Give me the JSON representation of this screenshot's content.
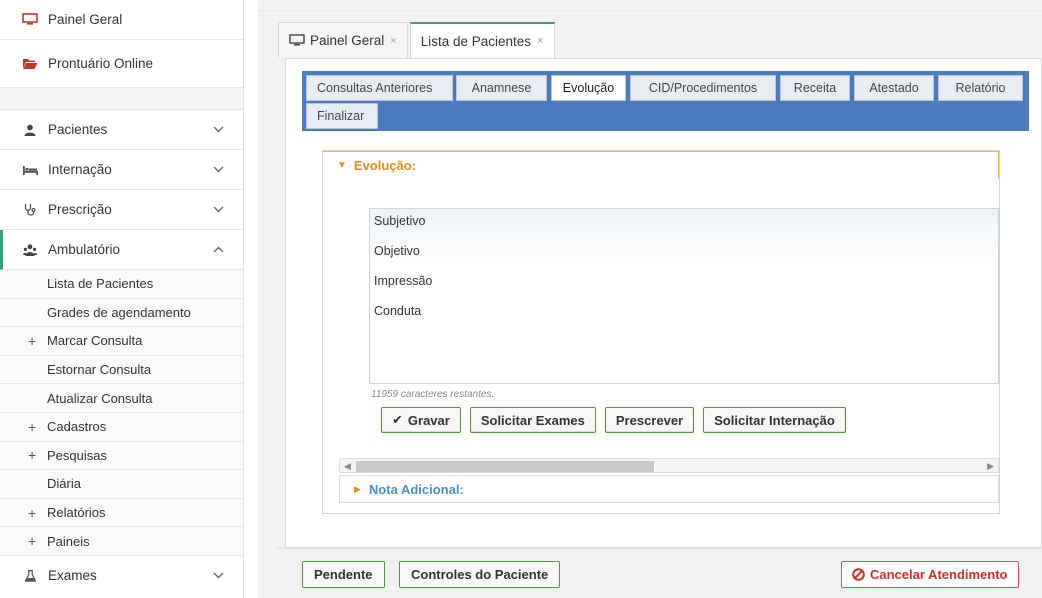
{
  "sidebar": {
    "top_items": [
      {
        "label": "Painel Geral",
        "icon": "monitor-icon"
      },
      {
        "label": "Prontuário Online",
        "icon": "folder-open-icon"
      }
    ],
    "sections": [
      {
        "label": "Pacientes",
        "icon": "user-icon"
      },
      {
        "label": "Internação",
        "icon": "bed-icon"
      },
      {
        "label": "Prescrição",
        "icon": "stethoscope-icon"
      },
      {
        "label": "Ambulatório",
        "icon": "users-icon"
      }
    ],
    "sub_items": [
      {
        "label": "Lista de Pacientes",
        "plus": ""
      },
      {
        "label": "Grades de agendamento",
        "plus": ""
      },
      {
        "label": "Marcar Consulta",
        "plus": "+"
      },
      {
        "label": "Estornar Consulta",
        "plus": ""
      },
      {
        "label": "Atualizar Consulta",
        "plus": ""
      },
      {
        "label": "Cadastros",
        "plus": "+"
      },
      {
        "label": "Pesquisas",
        "plus": "+"
      },
      {
        "label": "Diária",
        "plus": ""
      },
      {
        "label": "Relatórios",
        "plus": "+"
      },
      {
        "label": "Paineis",
        "plus": "+"
      }
    ],
    "exames": {
      "label": "Exames",
      "icon": "flask-icon"
    }
  },
  "page_tabs": [
    {
      "label": "Painel Geral",
      "close": "×"
    },
    {
      "label": "Lista de Pacientes",
      "close": "×"
    }
  ],
  "record_tabs": [
    "Consultas Anteriores",
    "Anamnese",
    "Evolução",
    "CID/Procedimentos",
    "Receita",
    "Atestado",
    "Relatório",
    "Finalizar"
  ],
  "evolucao": {
    "title": "Evolução:",
    "lines": [
      "Subjetivo",
      "Objetivo",
      "Impressão",
      "Conduta"
    ],
    "counter": "11959 caracteres restantes.",
    "buttons": {
      "gravar": "Gravar",
      "solicitar_exames": "Solicitar Exames",
      "prescrever": "Prescrever",
      "solicitar_internacao": "Solicitar Internação"
    }
  },
  "nota": {
    "title": "Nota Adicional:"
  },
  "footer": {
    "pendente": "Pendente",
    "controles": "Controles do Paciente",
    "cancelar": "Cancelar Atendimento"
  },
  "colors": {
    "accent": "#3a9e7a",
    "tabbar": "#4a7bc0",
    "orange": "#e0901c",
    "green_border": "#4e9a3a",
    "danger": "#c9302c"
  }
}
